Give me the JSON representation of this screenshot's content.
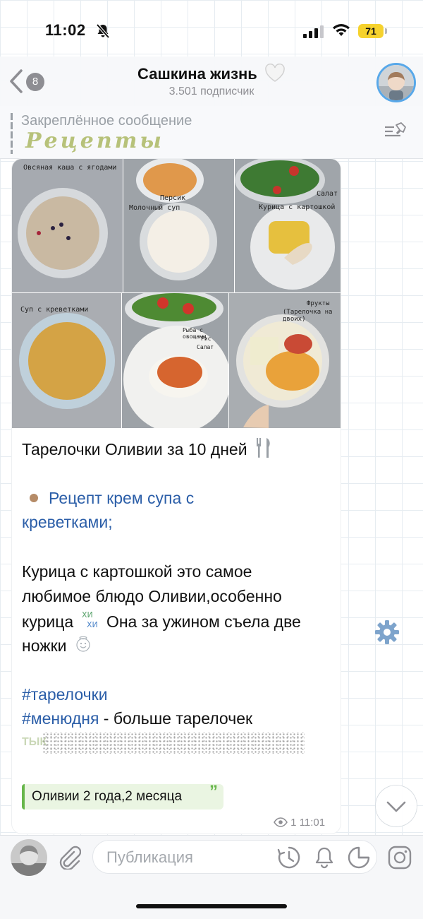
{
  "status": {
    "time": "11:02",
    "battery": "71"
  },
  "header": {
    "back_count": "8",
    "title": "Сашкина жизнь",
    "subscribers": "3.501 подписчик"
  },
  "pinned": {
    "label": "Закреплённое сообщение",
    "text": "Рецепты"
  },
  "photos": [
    {
      "label": "Овсяная каша с ягодами"
    },
    {
      "label": "Персик",
      "label2": "Молочный суп"
    },
    {
      "label": "Салат",
      "label2": "Курица с картошкой"
    },
    {
      "label": "Суп с креветками"
    },
    {
      "label": "Рыба с овощами",
      "label2": "Рис",
      "label3": "Салат"
    },
    {
      "label": "Фрукты",
      "label2": "(Тарелочка на двоих)"
    }
  ],
  "message": {
    "title": "Тарелочки Оливии за 10 дней",
    "link_text": "Рецепт крем супа с",
    "link_text2": "креветками;",
    "para_line1": "Курица с картошкой это самое",
    "para_line2": "любимое блюдо Оливии,особенно",
    "para_line3a": "курица",
    "para_line3b": "Она за ужином съела две",
    "para_line4": "ножки",
    "hashtag1": "#тарелочки",
    "hashtag2": "#менюдня",
    "hashtag2_suffix": " - больше тарелочек",
    "tyk": "ТЫК",
    "quote": "Оливии 2 года,2 месяца",
    "quote_mark": "”",
    "views": "1",
    "time": "11:01"
  },
  "composer": {
    "placeholder": "Публикация"
  },
  "icons": [
    "bell-off-icon",
    "signal-icon",
    "wifi-icon",
    "back-chevron-icon",
    "pinned-list-icon",
    "fork-knife-emoji",
    "dot-emoji",
    "hihi-emoji",
    "smile-emoji",
    "eye-icon",
    "gear-icon",
    "chevron-down-icon",
    "paperclip-icon",
    "clock-icon",
    "bell-icon",
    "sticker-icon",
    "instagram-icon"
  ],
  "colors": {
    "link": "#2b5ea8",
    "accent_blue": "#58a8e9",
    "quote_green": "#67b64a",
    "battery": "#f6d22d",
    "pinned_text": "#b7c27a"
  }
}
